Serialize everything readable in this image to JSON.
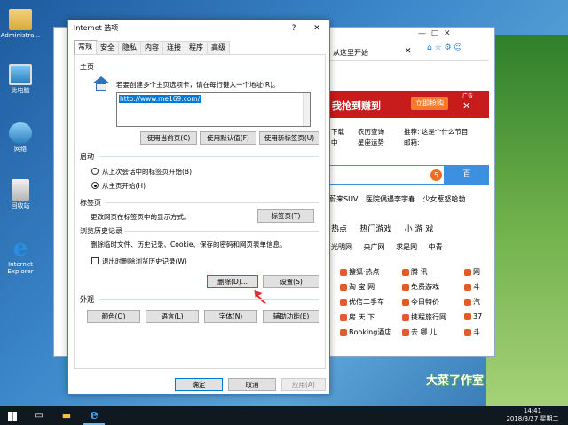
{
  "desktop": {
    "icons": [
      {
        "label": "Administra...",
        "icon": "user-folder-icon"
      },
      {
        "label": "此电脑",
        "icon": "computer-icon"
      },
      {
        "label": "网络",
        "icon": "network-icon"
      },
      {
        "label": "回收站",
        "icon": "recycle-bin-icon"
      },
      {
        "label": "Internet Explorer",
        "icon": "ie-icon"
      }
    ]
  },
  "browser": {
    "tab_title": "从这里开始",
    "ad_title": "我抢到赚到",
    "ad_button": "立即抢购",
    "ad_tag": "广告",
    "info": [
      "农历查询",
      "星座运势",
      "推荐:",
      "这是个什么节目",
      "邮箱:"
    ],
    "info2": [
      "下载",
      "中",
      "万年历",
      "卡"
    ],
    "news": [
      "蔚来SUV",
      "医院偶遇李宇春",
      "少女惹怒哈勃"
    ],
    "nav": [
      "热点",
      "热门游戏",
      "小 游 戏"
    ],
    "sites": [
      "光明网",
      "央广网",
      "求是网",
      "中青"
    ],
    "links": [
      {
        "name": "搜狐·热点",
        "icon": "sohu-icon"
      },
      {
        "name": "腾 讯",
        "icon": "tencent-icon"
      },
      {
        "name": "网",
        "icon": "netease-icon"
      },
      {
        "name": "淘 宝 网",
        "icon": "taobao-icon"
      },
      {
        "name": "免费游戏",
        "icon": "game-icon"
      },
      {
        "name": "斗",
        "icon": "douyu-icon"
      },
      {
        "name": "优信二手车",
        "icon": "car-icon"
      },
      {
        "name": "今日特价",
        "icon": "sale-icon"
      },
      {
        "name": "汽",
        "icon": "auto-icon"
      },
      {
        "name": "房 天 下",
        "icon": "house-icon"
      },
      {
        "name": "携程旅行网",
        "icon": "ctrip-icon"
      },
      {
        "name": "37",
        "icon": "g37-icon"
      },
      {
        "name": "Booking酒店",
        "icon": "booking-icon"
      },
      {
        "name": "去 哪 儿",
        "icon": "qunar-icon"
      },
      {
        "name": "斗",
        "icon": "douyu-icon"
      }
    ],
    "badge": "5",
    "watermark": "大菜了作室"
  },
  "dialog": {
    "title": "Internet 选项",
    "help": "?",
    "close": "✕",
    "tabs": [
      "常规",
      "安全",
      "隐私",
      "内容",
      "连接",
      "程序",
      "高级"
    ],
    "home": {
      "section": "主页",
      "desc": "若要创建多个主页选项卡，请在每行键入一个地址(R)。",
      "url": "http://www.me169.com/",
      "btn_current": "使用当前页(C)",
      "btn_default": "使用默认值(F)",
      "btn_newtab": "使用新标签页(U)"
    },
    "startup": {
      "section": "启动",
      "opt_last": "从上次会话中的标签页开始(B)",
      "opt_home": "从主页开始(H)"
    },
    "tabs_section": {
      "section": "标签页",
      "desc": "更改网页在标签页中的显示方式。",
      "btn": "标签页(T)"
    },
    "history": {
      "section": "浏览历史记录",
      "desc": "删除临时文件、历史记录、Cookie、保存的密码和网页表单信息。",
      "check_label": "退出时删除浏览历史记录(W)",
      "btn_delete": "删除(D)...",
      "btn_settings": "设置(S)"
    },
    "appearance": {
      "section": "外观",
      "btn_colors": "颜色(O)",
      "btn_lang": "语言(L)",
      "btn_fonts": "字体(N)",
      "btn_access": "辅助功能(E)"
    },
    "footer": {
      "ok": "确定",
      "cancel": "取消",
      "apply": "应用(A)"
    }
  },
  "taskbar": {
    "time": "14:41",
    "date": "2018/3/27 星期二"
  }
}
